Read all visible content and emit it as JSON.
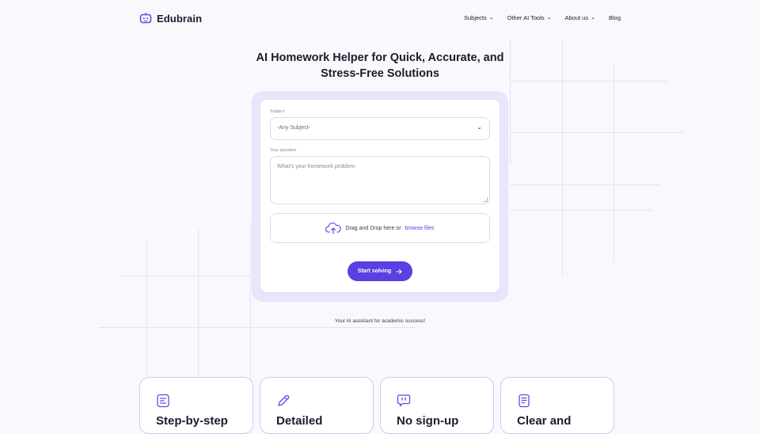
{
  "brand": {
    "name": "Edubrain",
    "accent": "#5b3fe0"
  },
  "nav": [
    {
      "label": "Subjects",
      "has_dropdown": true
    },
    {
      "label": "Other AI Tools",
      "has_dropdown": true
    },
    {
      "label": "About us",
      "has_dropdown": true
    },
    {
      "label": "Blog",
      "has_dropdown": false
    }
  ],
  "hero": {
    "title_line1": "AI Homework Helper for Quick, Accurate, and",
    "title_line2": "Stress-Free Solutions"
  },
  "form": {
    "subject_label": "Subject",
    "subject_value": "-Any Subject-",
    "question_label": "Your question",
    "question_placeholder": "What's your homework problem",
    "upload_text": "Drag and Drop here or",
    "upload_link": "browse files",
    "submit_label": "Start solving"
  },
  "tagline": "Your AI assistant for academic success!",
  "features": [
    {
      "title": "Step-by-step",
      "icon": "list-icon"
    },
    {
      "title": "Detailed",
      "icon": "pencil-icon"
    },
    {
      "title": "No sign-up",
      "icon": "quote-chat-icon"
    },
    {
      "title": "Clear and",
      "icon": "document-icon"
    }
  ]
}
